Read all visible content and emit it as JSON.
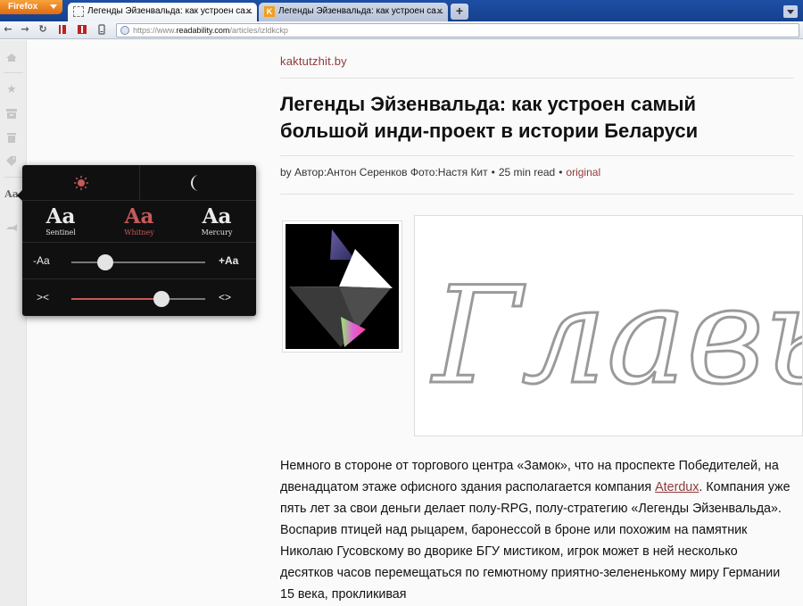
{
  "browser": {
    "app_button": "Firefox",
    "tabs": [
      {
        "title": "Легенды Эйзенвальда: как устроен са...",
        "active": true
      },
      {
        "title": "Легенды Эйзенвальда: как устроен са...",
        "active": false
      }
    ],
    "new_tab": "+",
    "url_prefix": "https://www.",
    "url_domain": "readability.com",
    "url_path": "/articles/izldkckp"
  },
  "rail": {
    "icons": [
      "home-icon",
      "star-icon",
      "archive-icon",
      "trash-icon",
      "tag-icon",
      "font-settings-icon",
      "share-icon"
    ],
    "aa_label": "Aa"
  },
  "popup": {
    "fonts": [
      {
        "sample": "Aa",
        "name": "Sentinel",
        "selected": false
      },
      {
        "sample": "Aa",
        "name": "Whitney",
        "selected": true
      },
      {
        "sample": "Aa",
        "name": "Mercury",
        "selected": false
      }
    ],
    "size_minus": "-Aa",
    "size_plus": "+Aa",
    "size_level": 0.25,
    "width_narrow": "><",
    "width_wide": "<>",
    "width_level": 0.67,
    "accent_color": "#c65a5a"
  },
  "article": {
    "domain": "kaktutzhit.by",
    "title": "Легенды Эйзенвальда: как устроен самый большой инди-проект в истории Беларуси",
    "byline_by": "by Автор:Антон Серенков Фото:Настя Кит",
    "read_time": "25 min read",
    "original_link": "original",
    "image_caption_art": "Главы",
    "para_1": "Немного в стороне от торгового центра «Замок», что на проспекте Победителей, на двенадцатом этаже офисного здания располагается компания ",
    "para_link": "Aterdux",
    "para_2": ". Компания уже пять лет за свои деньги делает полу-RPG, полу-стратегию «Легенды Эйзенвальда». Воспарив птицей над рыцарем, баронессой в броне или похожим на памятник Николаю Гусовскому во дворике БГУ мистиком, игрок может в ней несколько десятков часов перемещаться по гемютному приятно-зелененькому миру Германии 15 века, прокликивая"
  }
}
